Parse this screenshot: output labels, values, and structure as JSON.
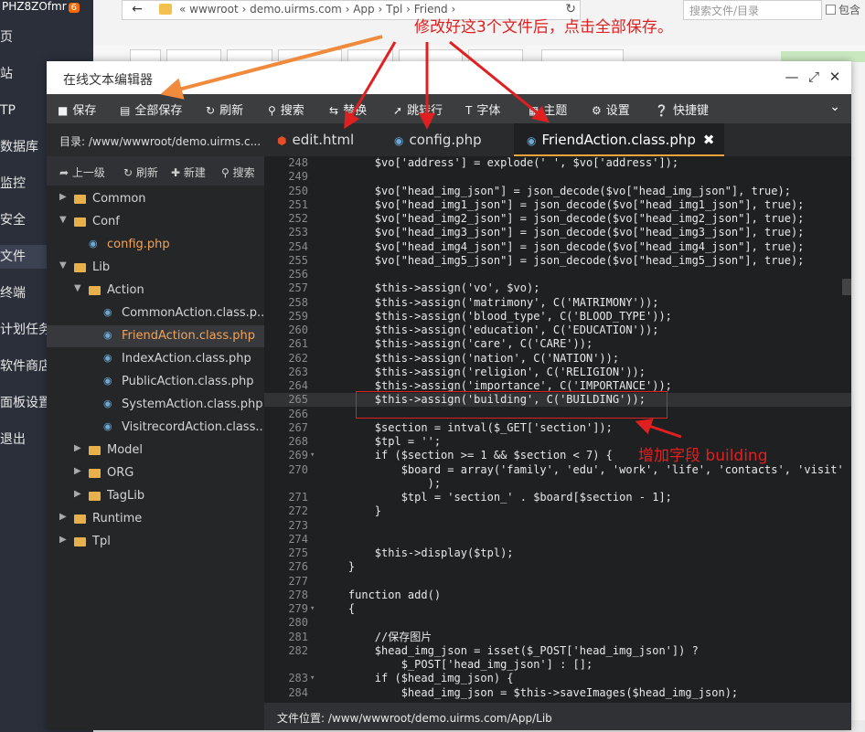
{
  "background": {
    "logo": "PHZ8ZOfmr",
    "logo_badge": "6",
    "sidebar": [
      "页",
      "站",
      "TP",
      "数据库",
      "监控",
      "安全",
      "文件",
      "终端",
      "计划任务",
      "软件商店",
      "面板设置",
      "退出"
    ],
    "address": {
      "path": "« wwwroot › demo.uirms.com › App › Tpl › Friend ›",
      "back_icon": "arrow-left-icon",
      "refresh_icon": "refresh-icon"
    },
    "search_placeholder": "搜索文件/目录",
    "checkbox_label": "包含"
  },
  "editor": {
    "window_title": "在线文本编辑器",
    "controls": [
      "—",
      "⤢",
      "✕"
    ],
    "toolbar": [
      {
        "label": "保存",
        "icon": "save-icon"
      },
      {
        "label": "全部保存",
        "icon": "save-all-icon"
      },
      {
        "label": "刷新",
        "icon": "refresh-icon"
      },
      {
        "label": "搜索",
        "icon": "search-icon"
      },
      {
        "label": "替换",
        "icon": "replace-icon"
      },
      {
        "label": "跳转行",
        "icon": "goto-icon"
      },
      {
        "label": "字体",
        "icon": "font-icon"
      },
      {
        "label": "主题",
        "icon": "theme-icon"
      },
      {
        "label": "设置",
        "icon": "gear-icon"
      },
      {
        "label": "快捷键",
        "icon": "info-icon"
      }
    ],
    "filepanel": {
      "dir_label": "目录: /www/wwwroot/demo.uirms.c...",
      "tools": [
        "上一级",
        "刷新",
        "新建",
        "搜索"
      ],
      "tree": [
        {
          "label": "Common",
          "kind": "folder",
          "expanded": false,
          "depth": 0
        },
        {
          "label": "Conf",
          "kind": "folder",
          "expanded": true,
          "depth": 0
        },
        {
          "label": "config.php",
          "kind": "php",
          "depth": 1,
          "selected": true
        },
        {
          "label": "Lib",
          "kind": "folder",
          "expanded": true,
          "depth": 0
        },
        {
          "label": "Action",
          "kind": "folder",
          "expanded": true,
          "depth": 1
        },
        {
          "label": "CommonAction.class.p...",
          "kind": "php",
          "depth": 2
        },
        {
          "label": "FriendAction.class.php",
          "kind": "php",
          "depth": 2,
          "selected": true
        },
        {
          "label": "IndexAction.class.php",
          "kind": "php",
          "depth": 2
        },
        {
          "label": "PublicAction.class.php",
          "kind": "php",
          "depth": 2
        },
        {
          "label": "SystemAction.class.php",
          "kind": "php",
          "depth": 2
        },
        {
          "label": "VisitrecordAction.class....",
          "kind": "php",
          "depth": 2
        },
        {
          "label": "Model",
          "kind": "folder",
          "expanded": false,
          "depth": 1
        },
        {
          "label": "ORG",
          "kind": "folder",
          "expanded": false,
          "depth": 1
        },
        {
          "label": "TagLib",
          "kind": "folder",
          "expanded": false,
          "depth": 1
        },
        {
          "label": "Runtime",
          "kind": "folder",
          "expanded": false,
          "depth": 0
        },
        {
          "label": "Tpl",
          "kind": "folder",
          "expanded": false,
          "depth": 0
        }
      ]
    },
    "tabs": [
      {
        "label": "edit.html",
        "icon": "html5-icon"
      },
      {
        "label": "config.php",
        "icon": "php-icon"
      },
      {
        "label": "FriendAction.class.php",
        "icon": "php-icon",
        "active": true,
        "close": "✖"
      }
    ],
    "code_lines": [
      {
        "n": "248",
        "t": "        $vo['address'] = explode(' ', $vo['address']);"
      },
      {
        "n": "249",
        "t": ""
      },
      {
        "n": "250",
        "t": "        $vo[\"head_img_json\"] = json_decode($vo[\"head_img_json\"], true);"
      },
      {
        "n": "251",
        "t": "        $vo[\"head_img1_json\"] = json_decode($vo[\"head_img1_json\"], true);"
      },
      {
        "n": "252",
        "t": "        $vo[\"head_img2_json\"] = json_decode($vo[\"head_img2_json\"], true);"
      },
      {
        "n": "253",
        "t": "        $vo[\"head_img3_json\"] = json_decode($vo[\"head_img3_json\"], true);"
      },
      {
        "n": "254",
        "t": "        $vo[\"head_img4_json\"] = json_decode($vo[\"head_img4_json\"], true);"
      },
      {
        "n": "255",
        "t": "        $vo[\"head_img5_json\"] = json_decode($vo[\"head_img5_json\"], true);"
      },
      {
        "n": "256",
        "t": ""
      },
      {
        "n": "257",
        "t": "        $this->assign('vo', $vo);"
      },
      {
        "n": "258",
        "t": "        $this->assign('matrimony', C('MATRIMONY'));"
      },
      {
        "n": "259",
        "t": "        $this->assign('blood_type', C('BLOOD_TYPE'));"
      },
      {
        "n": "260",
        "t": "        $this->assign('education', C('EDUCATION'));"
      },
      {
        "n": "261",
        "t": "        $this->assign('care', C('CARE'));"
      },
      {
        "n": "262",
        "t": "        $this->assign('nation', C('NATION'));"
      },
      {
        "n": "263",
        "t": "        $this->assign('religion', C('RELIGION'));"
      },
      {
        "n": "264",
        "t": "        $this->assign('importance', C('IMPORTANCE'));"
      },
      {
        "n": "265",
        "t": "        $this->assign('building', C('BUILDING'));",
        "hl": true
      },
      {
        "n": "266",
        "t": ""
      },
      {
        "n": "267",
        "t": "        $section = intval($_GET['section']);"
      },
      {
        "n": "268",
        "t": "        $tpl = '';"
      },
      {
        "n": "269",
        "t": "        if ($section >= 1 && $section < 7) {",
        "fold": true
      },
      {
        "n": "270",
        "t": "            $board = array('family', 'edu', 'work', 'life', 'contacts', 'visit'"
      },
      {
        "n": "",
        "t": "                );"
      },
      {
        "n": "271",
        "t": "            $tpl = 'section_' . $board[$section - 1];"
      },
      {
        "n": "272",
        "t": "        }"
      },
      {
        "n": "273",
        "t": ""
      },
      {
        "n": "274",
        "t": ""
      },
      {
        "n": "275",
        "t": "        $this->display($tpl);"
      },
      {
        "n": "276",
        "t": "    }"
      },
      {
        "n": "277",
        "t": ""
      },
      {
        "n": "278",
        "t": "    function add()"
      },
      {
        "n": "279",
        "t": "    {",
        "fold": true
      },
      {
        "n": "280",
        "t": ""
      },
      {
        "n": "281",
        "t": "        //保存图片"
      },
      {
        "n": "282",
        "t": "        $head_img_json = isset($_POST['head_img_json']) ?"
      },
      {
        "n": "",
        "t": "            $_POST['head_img_json'] : [];"
      },
      {
        "n": "283",
        "t": "        if ($head_img_json) {",
        "fold": true
      },
      {
        "n": "284",
        "t": "            $head_img_json = $this->saveImages($head_img_json);"
      }
    ],
    "status": "文件位置: /www/wwwroot/demo.uirms.com/App/Lib"
  },
  "annotations": {
    "top": "修改好这3个文件后，点击全部保存。",
    "side": "增加字段 building",
    "color": "#e02020"
  }
}
